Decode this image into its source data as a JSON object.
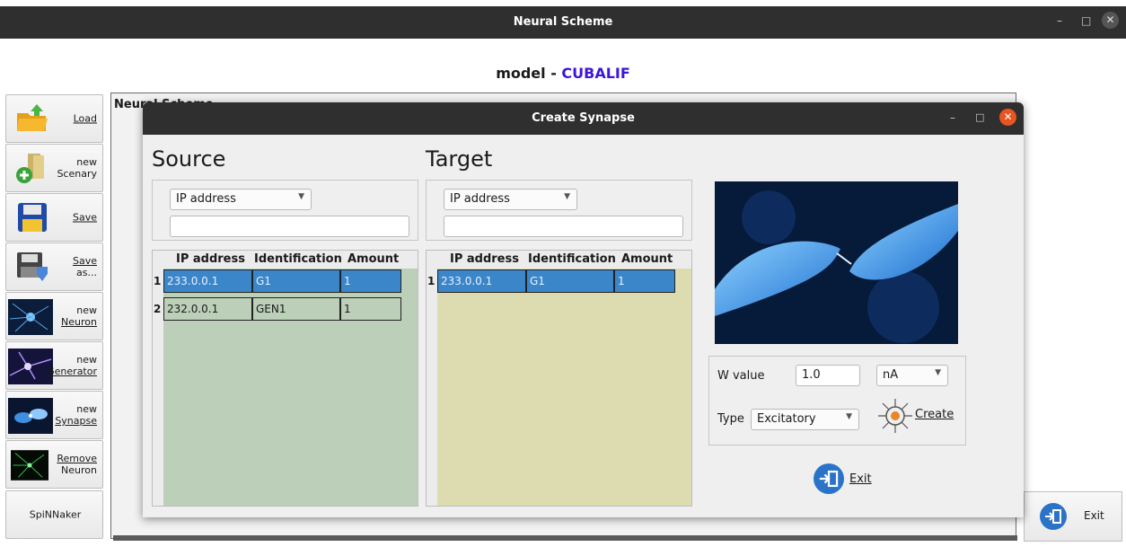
{
  "window": {
    "title": "Neural Scheme"
  },
  "model": {
    "prefix": "model - ",
    "name": "CUBALIF",
    "name_color": "#3d16d9"
  },
  "sidebar": {
    "items": [
      {
        "label1": "Load",
        "label2": "",
        "icon": "folder-icon"
      },
      {
        "label1": "new",
        "label2": "Scenary",
        "icon": "new-scenary-icon"
      },
      {
        "label1": "Save",
        "label2": "",
        "icon": "save-icon"
      },
      {
        "label1": "Save",
        "label2": "as...",
        "icon": "save-as-icon"
      },
      {
        "label1": "new",
        "label2": "Neuron",
        "icon": "neuron-image"
      },
      {
        "label1": "new",
        "label2": "Generator",
        "icon": "generator-image"
      },
      {
        "label1": "new",
        "label2": "Synapse",
        "icon": "synapse-image"
      },
      {
        "label1": "Remove",
        "label2": "Neuron",
        "icon": "remove-neuron-image"
      },
      {
        "label1": "SpiNNaker",
        "label2": "",
        "icon": ""
      }
    ]
  },
  "background_window": {
    "title": "Neural Scheme"
  },
  "dialog": {
    "title": "Create Synapse",
    "source": {
      "heading": "Source",
      "filter_option": "IP address",
      "search_value": "",
      "columns": [
        "IP address",
        "Identification",
        "Amount"
      ],
      "rows": [
        {
          "num": "1",
          "ip": "233.0.0.1",
          "id": "G1",
          "amount": "1"
        },
        {
          "num": "2",
          "ip": "232.0.0.1",
          "id": "GEN1",
          "amount": "1"
        }
      ]
    },
    "target": {
      "heading": "Target",
      "filter_option": "IP address",
      "search_value": "",
      "columns": [
        "IP address",
        "Identification",
        "Amount"
      ],
      "rows": [
        {
          "num": "1",
          "ip": "233.0.0.1",
          "id": "G1",
          "amount": "1"
        }
      ]
    },
    "params": {
      "w_label": "W value",
      "w_value": "1.0",
      "unit": "nA",
      "type_label": "Type",
      "type_value": "Excitatory",
      "create_label": "Create"
    },
    "exit_label": "Exit"
  },
  "main_exit_label": "Exit",
  "colors": {
    "titlebar": "#2f2f2f",
    "accent_close": "#e95420",
    "selection": "#3b86c9",
    "source_table_bg": "#bccfb9",
    "target_table_bg": "#dcdcb0"
  }
}
